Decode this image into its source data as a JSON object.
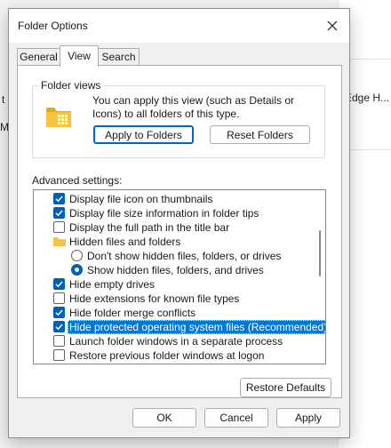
{
  "background": {
    "left_char_1": "t",
    "left_char_2": "M",
    "right_text": "Edge H..."
  },
  "dialog": {
    "title": "Folder Options",
    "close_label": "✕"
  },
  "tabs": [
    {
      "label": "General",
      "active": false
    },
    {
      "label": "View",
      "active": true
    },
    {
      "label": "Search",
      "active": false
    }
  ],
  "folder_views": {
    "legend": "Folder views",
    "description": "You can apply this view (such as Details or Icons) to all folders of this type.",
    "apply_button": "Apply to Folders",
    "reset_button": "Reset Folders"
  },
  "advanced": {
    "label": "Advanced settings:",
    "items": [
      {
        "label": "Display file icon on thumbnails",
        "type": "checkbox",
        "checked": true,
        "indent": 0
      },
      {
        "label": "Display file size information in folder tips",
        "type": "checkbox",
        "checked": true,
        "indent": 0
      },
      {
        "label": "Display the full path in the title bar",
        "type": "checkbox",
        "checked": false,
        "indent": 0
      },
      {
        "label": "Hidden files and folders",
        "type": "folder",
        "checked": false,
        "indent": 0
      },
      {
        "label": "Don't show hidden files, folders, or drives",
        "type": "radio",
        "checked": false,
        "indent": 1
      },
      {
        "label": "Show hidden files, folders, and drives",
        "type": "radio",
        "checked": true,
        "indent": 1
      },
      {
        "label": "Hide empty drives",
        "type": "checkbox",
        "checked": true,
        "indent": 0
      },
      {
        "label": "Hide extensions for known file types",
        "type": "checkbox",
        "checked": false,
        "indent": 0
      },
      {
        "label": "Hide folder merge conflicts",
        "type": "checkbox",
        "checked": true,
        "indent": 0
      },
      {
        "label": "Hide protected operating system files (Recommended)",
        "type": "checkbox",
        "checked": true,
        "indent": 0,
        "selected": true
      },
      {
        "label": "Launch folder windows in a separate process",
        "type": "checkbox",
        "checked": false,
        "indent": 0
      },
      {
        "label": "Restore previous folder windows at logon",
        "type": "checkbox",
        "checked": false,
        "indent": 0
      }
    ]
  },
  "restore_defaults": "Restore Defaults",
  "footer": {
    "ok": "OK",
    "cancel": "Cancel",
    "apply": "Apply"
  },
  "colors": {
    "accent": "#005fb8",
    "selection": "#0078d7",
    "folder": "#f6c343"
  }
}
